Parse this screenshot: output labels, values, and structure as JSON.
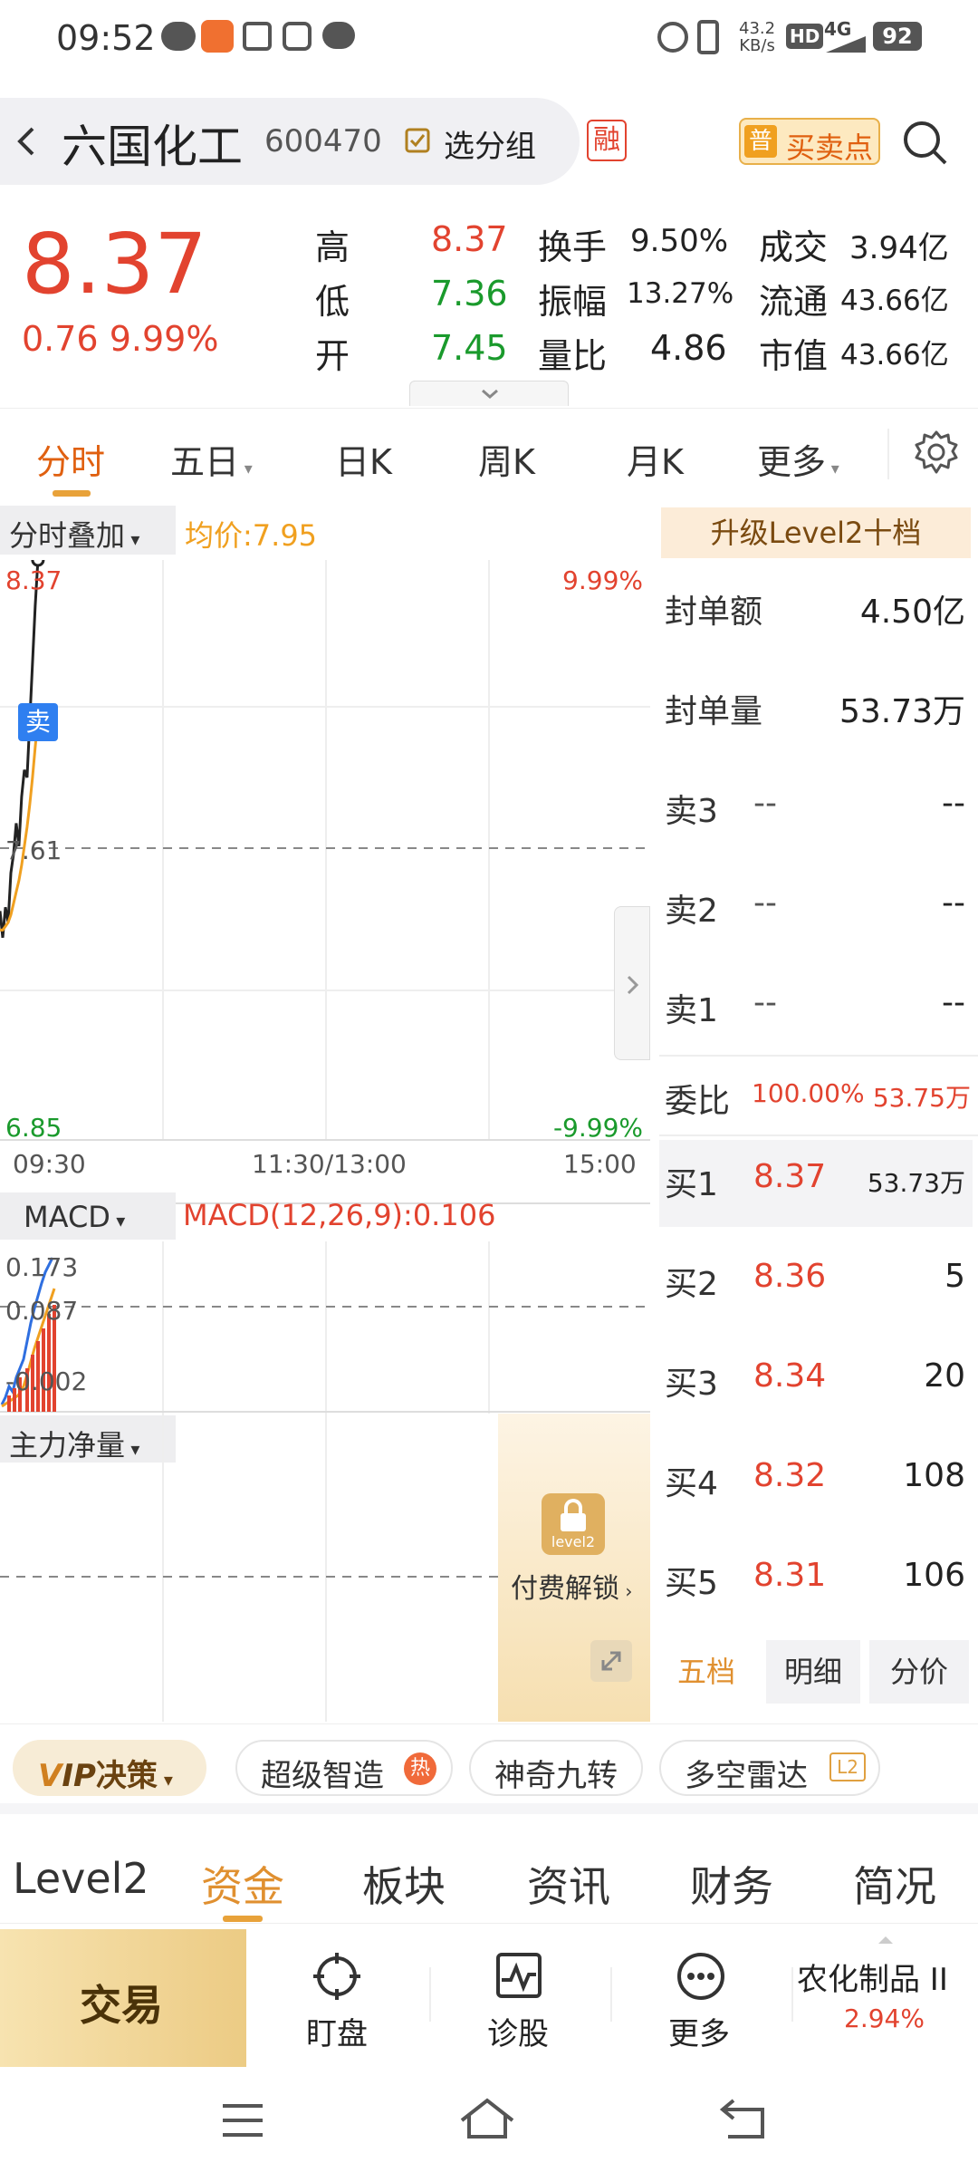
{
  "status_bar": {
    "time": "09:52",
    "net_speed_value": "43.2",
    "net_speed_unit": "KB/s",
    "hd": "HD",
    "signal": "4G",
    "battery": "92"
  },
  "header": {
    "name": "六国化工",
    "code": "600470",
    "group_label": "选分组",
    "margin_badge": "融",
    "trade_point_badge": "普",
    "trade_point_label": "买卖点"
  },
  "quote": {
    "price": "8.37",
    "change": "0.76",
    "change_pct": "9.99%",
    "high_label": "高",
    "high": "8.37",
    "low_label": "低",
    "low": "7.36",
    "open_label": "开",
    "open": "7.45",
    "turnover_label": "换手",
    "turnover": "9.50%",
    "amplitude_label": "振幅",
    "amplitude": "13.27%",
    "vol_ratio_label": "量比",
    "vol_ratio": "4.86",
    "amount_label": "成交",
    "amount": "3.94亿",
    "float_label": "流通",
    "float_cap": "43.66亿",
    "mcap_label": "市值",
    "mcap": "43.66亿"
  },
  "k_tabs": [
    "分时",
    "五日",
    "日K",
    "周K",
    "月K",
    "更多"
  ],
  "chart": {
    "overlay_label": "分时叠加",
    "avg_label": "均价:7.95",
    "y_top": "8.37",
    "y_mid": "7.61",
    "y_bottom": "6.85",
    "pct_top": "9.99%",
    "pct_bottom": "-9.99%",
    "t_start": "09:30",
    "t_mid": "11:30/13:00",
    "t_end": "15:00",
    "sell_marker": "卖",
    "macd_selector": "MACD",
    "macd_label": "MACD(12,26,9):0.106",
    "macd_top": "0.173",
    "macd_mid": "0.087",
    "macd_bottom": "-0.002",
    "flow_selector": "主力净量",
    "lock_badge": "level2",
    "unlock_label": "付费解锁"
  },
  "chart_data": {
    "type": "line",
    "title": "",
    "x_range": [
      "09:30",
      "15:00"
    ],
    "ylim": [
      6.85,
      8.37
    ],
    "series": [
      {
        "name": "",
        "color": "#222222",
        "x": [
          "09:30",
          "09:31",
          "09:32",
          "09:33",
          "09:34",
          "09:35",
          "09:36",
          "09:37",
          "09:38",
          "09:39",
          "09:40",
          "09:41",
          "09:42",
          "09:43",
          "09:44"
        ],
        "values": [
          7.45,
          7.38,
          7.46,
          7.42,
          7.55,
          7.6,
          7.68,
          7.62,
          7.75,
          7.82,
          7.8,
          7.95,
          8.1,
          8.25,
          8.37
        ]
      },
      {
        "name": "",
        "color": "#f0a020",
        "x": [
          "09:30",
          "09:31",
          "09:32",
          "09:33",
          "09:34",
          "09:35",
          "09:36",
          "09:37",
          "09:38",
          "09:39",
          "09:40",
          "09:41",
          "09:42",
          "09:43",
          "09:44"
        ],
        "values": [
          7.4,
          7.4,
          7.41,
          7.42,
          7.44,
          7.47,
          7.5,
          7.53,
          7.57,
          7.62,
          7.67,
          7.73,
          7.8,
          7.88,
          7.95
        ]
      }
    ]
  },
  "level2": {
    "upgrade_label": "升级Level2十档",
    "seal_amount_label": "封单额",
    "seal_amount": "4.50亿",
    "seal_volume_label": "封单量",
    "seal_volume": "53.73万",
    "asks": [
      {
        "label": "卖3",
        "price": "--",
        "vol": "--"
      },
      {
        "label": "卖2",
        "price": "--",
        "vol": "--"
      },
      {
        "label": "卖1",
        "price": "--",
        "vol": "--"
      }
    ],
    "ratio_label": "委比",
    "ratio": "100.00%",
    "ratio_vol": "53.75万",
    "bids": [
      {
        "label": "买1",
        "price": "8.37",
        "vol": "53.73万"
      },
      {
        "label": "买2",
        "price": "8.36",
        "vol": "5"
      },
      {
        "label": "买3",
        "price": "8.34",
        "vol": "20"
      },
      {
        "label": "买4",
        "price": "8.32",
        "vol": "108"
      },
      {
        "label": "买5",
        "price": "8.31",
        "vol": "106"
      }
    ],
    "tabs": [
      "五档",
      "明细",
      "分价"
    ]
  },
  "tools": {
    "vip_v": "V",
    "vip_ip": "IP",
    "vip_label": "决策",
    "items": [
      "超级智造",
      "神奇九转",
      "多空雷达"
    ],
    "hot_badge": "热",
    "l2_badge": "L2"
  },
  "bottom_tabs": [
    "Level2",
    "资金",
    "板块",
    "资讯",
    "财务",
    "简况"
  ],
  "nav": {
    "trade": "交易",
    "watch": "盯盘",
    "diagnose": "诊股",
    "more": "更多",
    "sector_name": "农化制品 II",
    "sector_pct": "2.94%"
  }
}
